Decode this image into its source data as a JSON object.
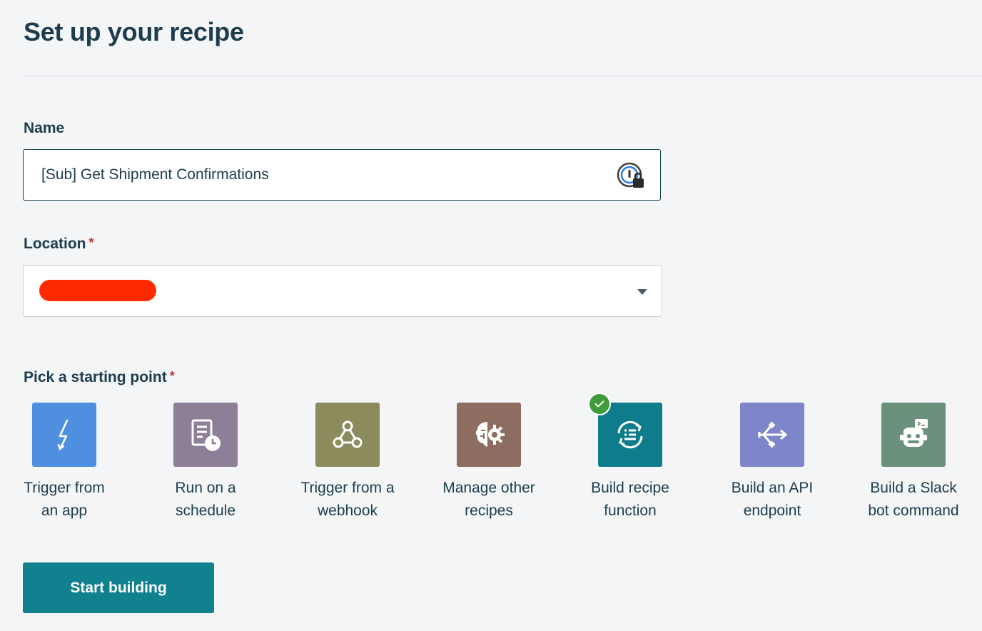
{
  "page": {
    "title": "Set up your recipe"
  },
  "name_field": {
    "label": "Name",
    "value": "[Sub] Get Shipment Confirmations",
    "password_manager_icon": "password-lock-icon"
  },
  "location_field": {
    "label": "Location",
    "required_marker": "*",
    "value": "",
    "value_redacted": true,
    "redaction_color": "#ff2a00"
  },
  "starting_point": {
    "label": "Pick a starting point",
    "required_marker": "*",
    "selected_index": 4,
    "options": [
      {
        "label": "Trigger from\nan app",
        "icon": "lightning-icon",
        "color": "#4f8fe0"
      },
      {
        "label": "Run on a\nschedule",
        "icon": "schedule-icon",
        "color": "#8e7f98"
      },
      {
        "label": "Trigger from a\nwebhook",
        "icon": "webhook-icon",
        "color": "#8b8b5c"
      },
      {
        "label": "Manage other\nrecipes",
        "icon": "brain-gear-icon",
        "color": "#8d6d5f"
      },
      {
        "label": "Build recipe\nfunction",
        "icon": "recipe-function-icon",
        "color": "#0f7c8b"
      },
      {
        "label": "Build an API\nendpoint",
        "icon": "api-endpoint-icon",
        "color": "#7c86c8"
      },
      {
        "label": "Build a Slack\nbot command",
        "icon": "slack-bot-icon",
        "color": "#6b917c"
      }
    ]
  },
  "selected_check_color": "#3e9c3a",
  "primary_button": {
    "label": "Start building",
    "color": "#11808f"
  }
}
